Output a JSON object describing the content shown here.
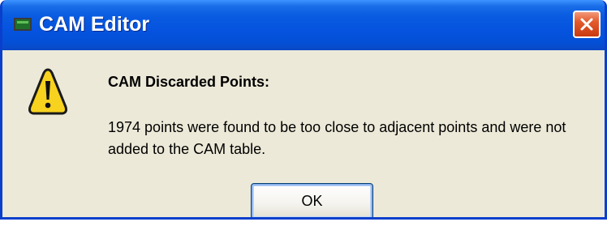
{
  "window": {
    "title": "CAM Editor",
    "icon": "app-icon",
    "close_icon": "close-icon"
  },
  "dialog": {
    "icon": "warning-icon",
    "heading": "CAM Discarded Points:",
    "message": "1974 points were found to be too close to adjacent points and were not added to the CAM table.",
    "ok_label": "OK"
  },
  "colors": {
    "titlebar": "#0553df",
    "body": "#ece9d8",
    "close": "#e35a2c",
    "warning": "#f7d21e"
  }
}
